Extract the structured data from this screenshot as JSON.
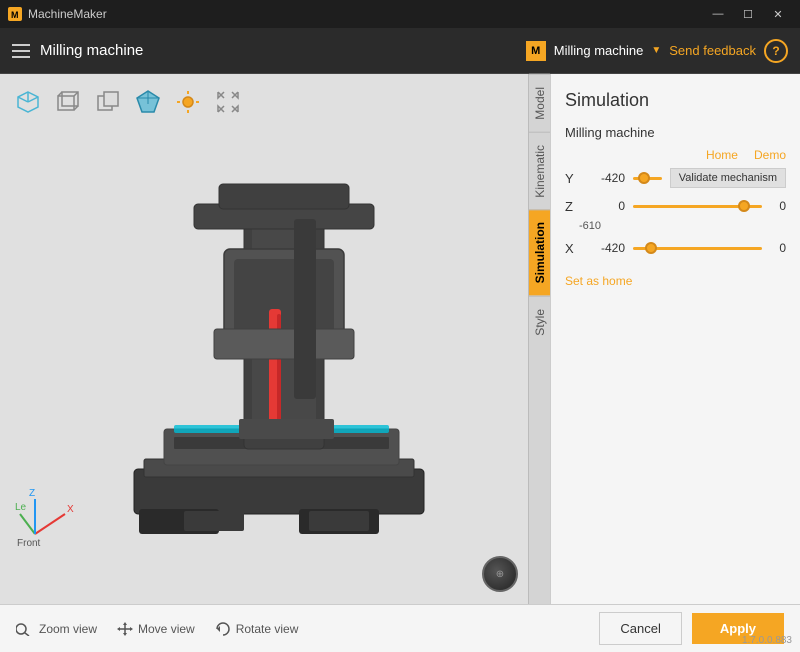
{
  "app": {
    "title": "MachineMaker",
    "machine_name": "Milling machine"
  },
  "titlebar": {
    "title": "MachineMaker",
    "minimize": "—",
    "maximize": "☐",
    "close": "✕"
  },
  "toolbar": {
    "hamburger_label": "menu",
    "machine_label": "Milling machine",
    "dropdown_arrow": "▼",
    "send_feedback": "Send feedback",
    "help": "?"
  },
  "view_icons": [
    {
      "name": "iso-view-icon",
      "label": "Iso"
    },
    {
      "name": "front-view-icon",
      "label": "Front"
    },
    {
      "name": "side-view-icon",
      "label": "Side"
    },
    {
      "name": "3d-view-icon",
      "label": "3D"
    },
    {
      "name": "light-icon",
      "label": "Light"
    },
    {
      "name": "expand-icon",
      "label": "Expand"
    }
  ],
  "side_tabs": [
    {
      "id": "model",
      "label": "Model",
      "active": false
    },
    {
      "id": "kinematic",
      "label": "Kinematic",
      "active": false
    },
    {
      "id": "simulation",
      "label": "Simulation",
      "active": true
    },
    {
      "id": "style",
      "label": "Style",
      "active": false
    }
  ],
  "panel": {
    "title": "Simulation",
    "section_label": "Milling machine",
    "home_label": "Home",
    "demo_label": "Demo",
    "validate_btn": "Validate mechanism",
    "axes": [
      {
        "label": "Y",
        "value": "-420",
        "slider_value": 30,
        "end_value": "-420"
      },
      {
        "label": "Z",
        "value": "0",
        "slider_value": 90,
        "end_value": "0"
      },
      {
        "label": "X",
        "value": "-420",
        "slider_value": 10,
        "end_value": "0"
      }
    ],
    "set_as_home": "Set as home"
  },
  "bottom": {
    "zoom_label": "Zoom view",
    "move_label": "Move view",
    "rotate_label": "Rotate view",
    "cancel_label": "Cancel",
    "apply_label": "Apply",
    "version": "1.7.0.0.883"
  }
}
